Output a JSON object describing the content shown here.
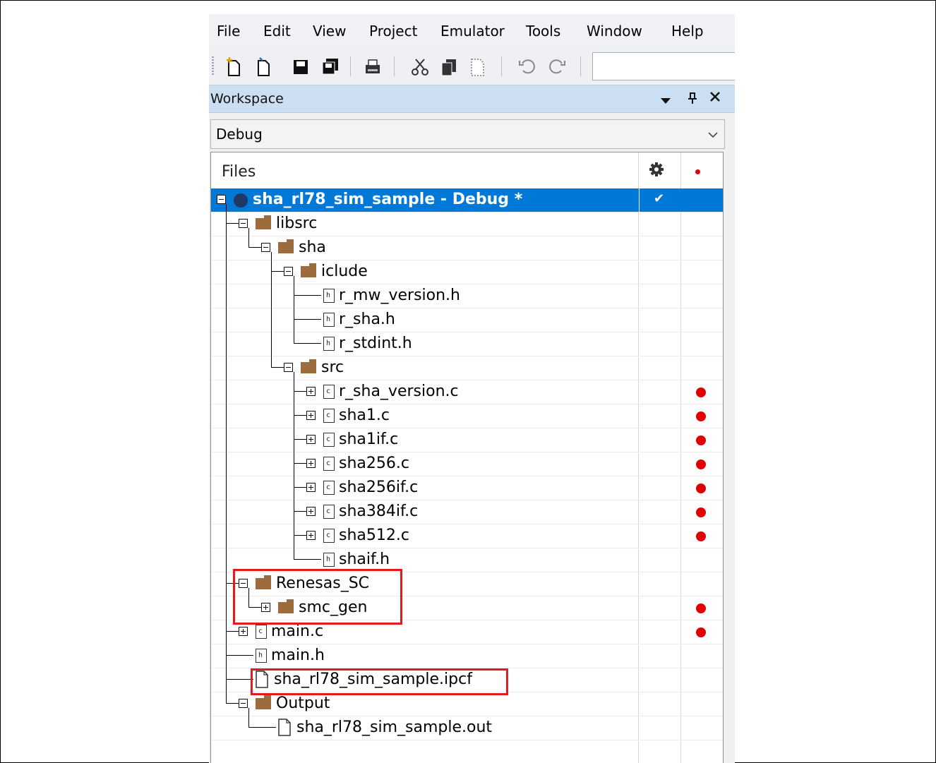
{
  "menubar": {
    "items": [
      "File",
      "Edit",
      "View",
      "Project",
      "Emulator",
      "Tools",
      "Window",
      "Help"
    ]
  },
  "toolbar": {
    "buttons": [
      "new-file-icon",
      "open-file-icon",
      "save-icon",
      "save-all-icon",
      "print-icon",
      "cut-icon",
      "copy-icon",
      "paste-icon",
      "undo-icon",
      "redo-icon"
    ]
  },
  "workspace": {
    "title": "Workspace",
    "controls": [
      "dropdown-arrow-icon",
      "pin-icon",
      "close-icon"
    ]
  },
  "config": {
    "selected": "Debug"
  },
  "tree": {
    "column_header": "Files",
    "header_icons": [
      "gear-icon",
      "red-dot-icon"
    ],
    "rows": [
      {
        "label": "sha_rl78_sim_sample - Debug *",
        "type": "project",
        "selected": true,
        "checked": true,
        "build_dot": false
      },
      {
        "label": "libsrc",
        "type": "folder",
        "build_dot": false
      },
      {
        "label": "sha",
        "type": "folder",
        "build_dot": false
      },
      {
        "label": "iclude",
        "type": "folder",
        "build_dot": false
      },
      {
        "label": "r_mw_version.h",
        "type": "header",
        "build_dot": false
      },
      {
        "label": "r_sha.h",
        "type": "header",
        "build_dot": false
      },
      {
        "label": "r_stdint.h",
        "type": "header",
        "build_dot": false
      },
      {
        "label": "src",
        "type": "folder",
        "build_dot": false
      },
      {
        "label": "r_sha_version.c",
        "type": "source",
        "build_dot": true
      },
      {
        "label": "sha1.c",
        "type": "source",
        "build_dot": true
      },
      {
        "label": "sha1if.c",
        "type": "source",
        "build_dot": true
      },
      {
        "label": "sha256.c",
        "type": "source",
        "build_dot": true
      },
      {
        "label": "sha256if.c",
        "type": "source",
        "build_dot": true
      },
      {
        "label": "sha384if.c",
        "type": "source",
        "build_dot": true
      },
      {
        "label": "sha512.c",
        "type": "source",
        "build_dot": true
      },
      {
        "label": "shaif.h",
        "type": "header",
        "build_dot": false
      },
      {
        "label": "Renesas_SC",
        "type": "folder",
        "build_dot": false
      },
      {
        "label": "smc_gen",
        "type": "folder",
        "build_dot": true
      },
      {
        "label": "main.c",
        "type": "source",
        "build_dot": true
      },
      {
        "label": "main.h",
        "type": "header",
        "build_dot": false
      },
      {
        "label": "sha_rl78_sim_sample.ipcf",
        "type": "file",
        "build_dot": false
      },
      {
        "label": "Output",
        "type": "folder",
        "build_dot": false
      },
      {
        "label": "sha_rl78_sim_sample.out",
        "type": "file",
        "build_dot": false
      }
    ]
  },
  "colors": {
    "selection": "#0078d7",
    "highlight_box": "#e21b1b",
    "build_dot": "#e00000",
    "folder": "#9c6b3e"
  }
}
